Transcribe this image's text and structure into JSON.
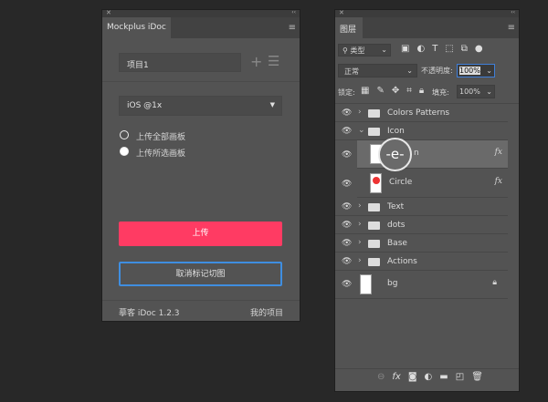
{
  "idoc": {
    "tab": "Mockplus iDoc",
    "project": "项目1",
    "add_icon": "plus-icon",
    "list_icon": "list-icon",
    "platform": "iOS @1x",
    "radio_all": "上传全部画板",
    "radio_selected": "上传所选画板",
    "selected_option": "上传所选画板",
    "upload": "上传",
    "cancel_mark": "取消标记切图",
    "version": "摹客 iDoc 1.2.3",
    "my_projects": "我的项目",
    "upload_color": "#ff3b63",
    "cancel_border": "#3f8ee0"
  },
  "layers": {
    "tab": "图层",
    "filter": "类型",
    "blend": "正常",
    "opacity_label": "不透明度:",
    "opacity": "100%",
    "lock_label": "锁定:",
    "fill_label": "填充:",
    "fill": "100%",
    "items": [
      {
        "name": "Colors Patterns",
        "type": "group"
      },
      {
        "name": "Icon",
        "type": "group",
        "expanded": true
      },
      {
        "name": "n",
        "type": "layer",
        "fx": "fx",
        "selected": true
      },
      {
        "name": "Circle",
        "type": "layer",
        "fx": "fx"
      },
      {
        "name": "Text",
        "type": "group"
      },
      {
        "name": "dots",
        "type": "group"
      },
      {
        "name": "Base",
        "type": "group"
      },
      {
        "name": "Actions",
        "type": "group"
      },
      {
        "name": "bg",
        "type": "layer",
        "locked": true
      }
    ],
    "magnifier": "-e-"
  }
}
